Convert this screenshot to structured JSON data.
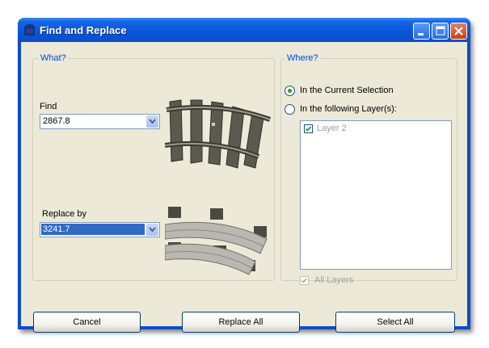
{
  "window": {
    "title": "Find and Replace",
    "icon": "brick-icon"
  },
  "what": {
    "legend": "What?",
    "find_label": "Find",
    "find_value": "2867.8",
    "replace_label": "Replace by",
    "replace_value": "3241.7"
  },
  "where": {
    "legend": "Where?",
    "option_selection": "In the Current Selection",
    "option_layers": "In the following Layer(s):",
    "selected_option": "selection",
    "layers": [
      {
        "name": "Layer 2",
        "checked": true
      }
    ],
    "all_layers_label": "All Layers",
    "all_layers_checked": true
  },
  "buttons": {
    "cancel": "Cancel",
    "replace_all": "Replace All",
    "select_all": "Select All"
  },
  "colors": {
    "titlebar": "#0a55d8",
    "accent": "#0046d5",
    "selection": "#316ac5"
  }
}
